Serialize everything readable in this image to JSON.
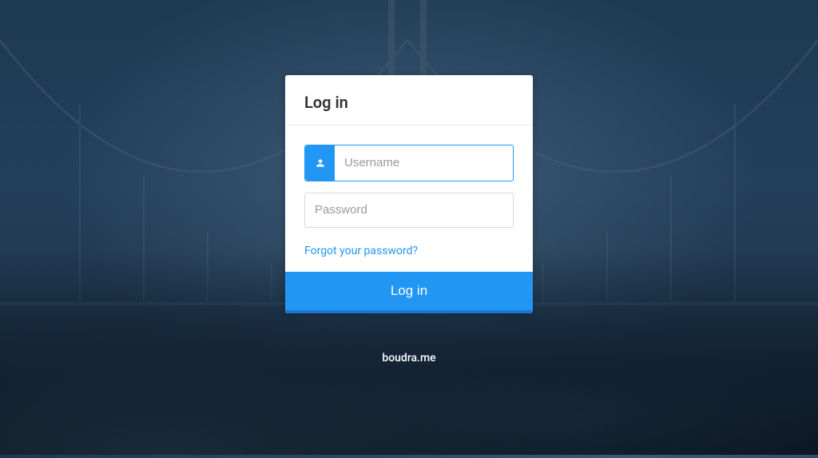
{
  "login": {
    "title": "Log in",
    "username_placeholder": "Username",
    "password_placeholder": "Password",
    "forgot_link": "Forgot your password?",
    "submit_label": "Log in"
  },
  "footer": {
    "text": "boudra.me"
  },
  "colors": {
    "accent": "#2196F3",
    "accent_dark": "#1976D2"
  }
}
